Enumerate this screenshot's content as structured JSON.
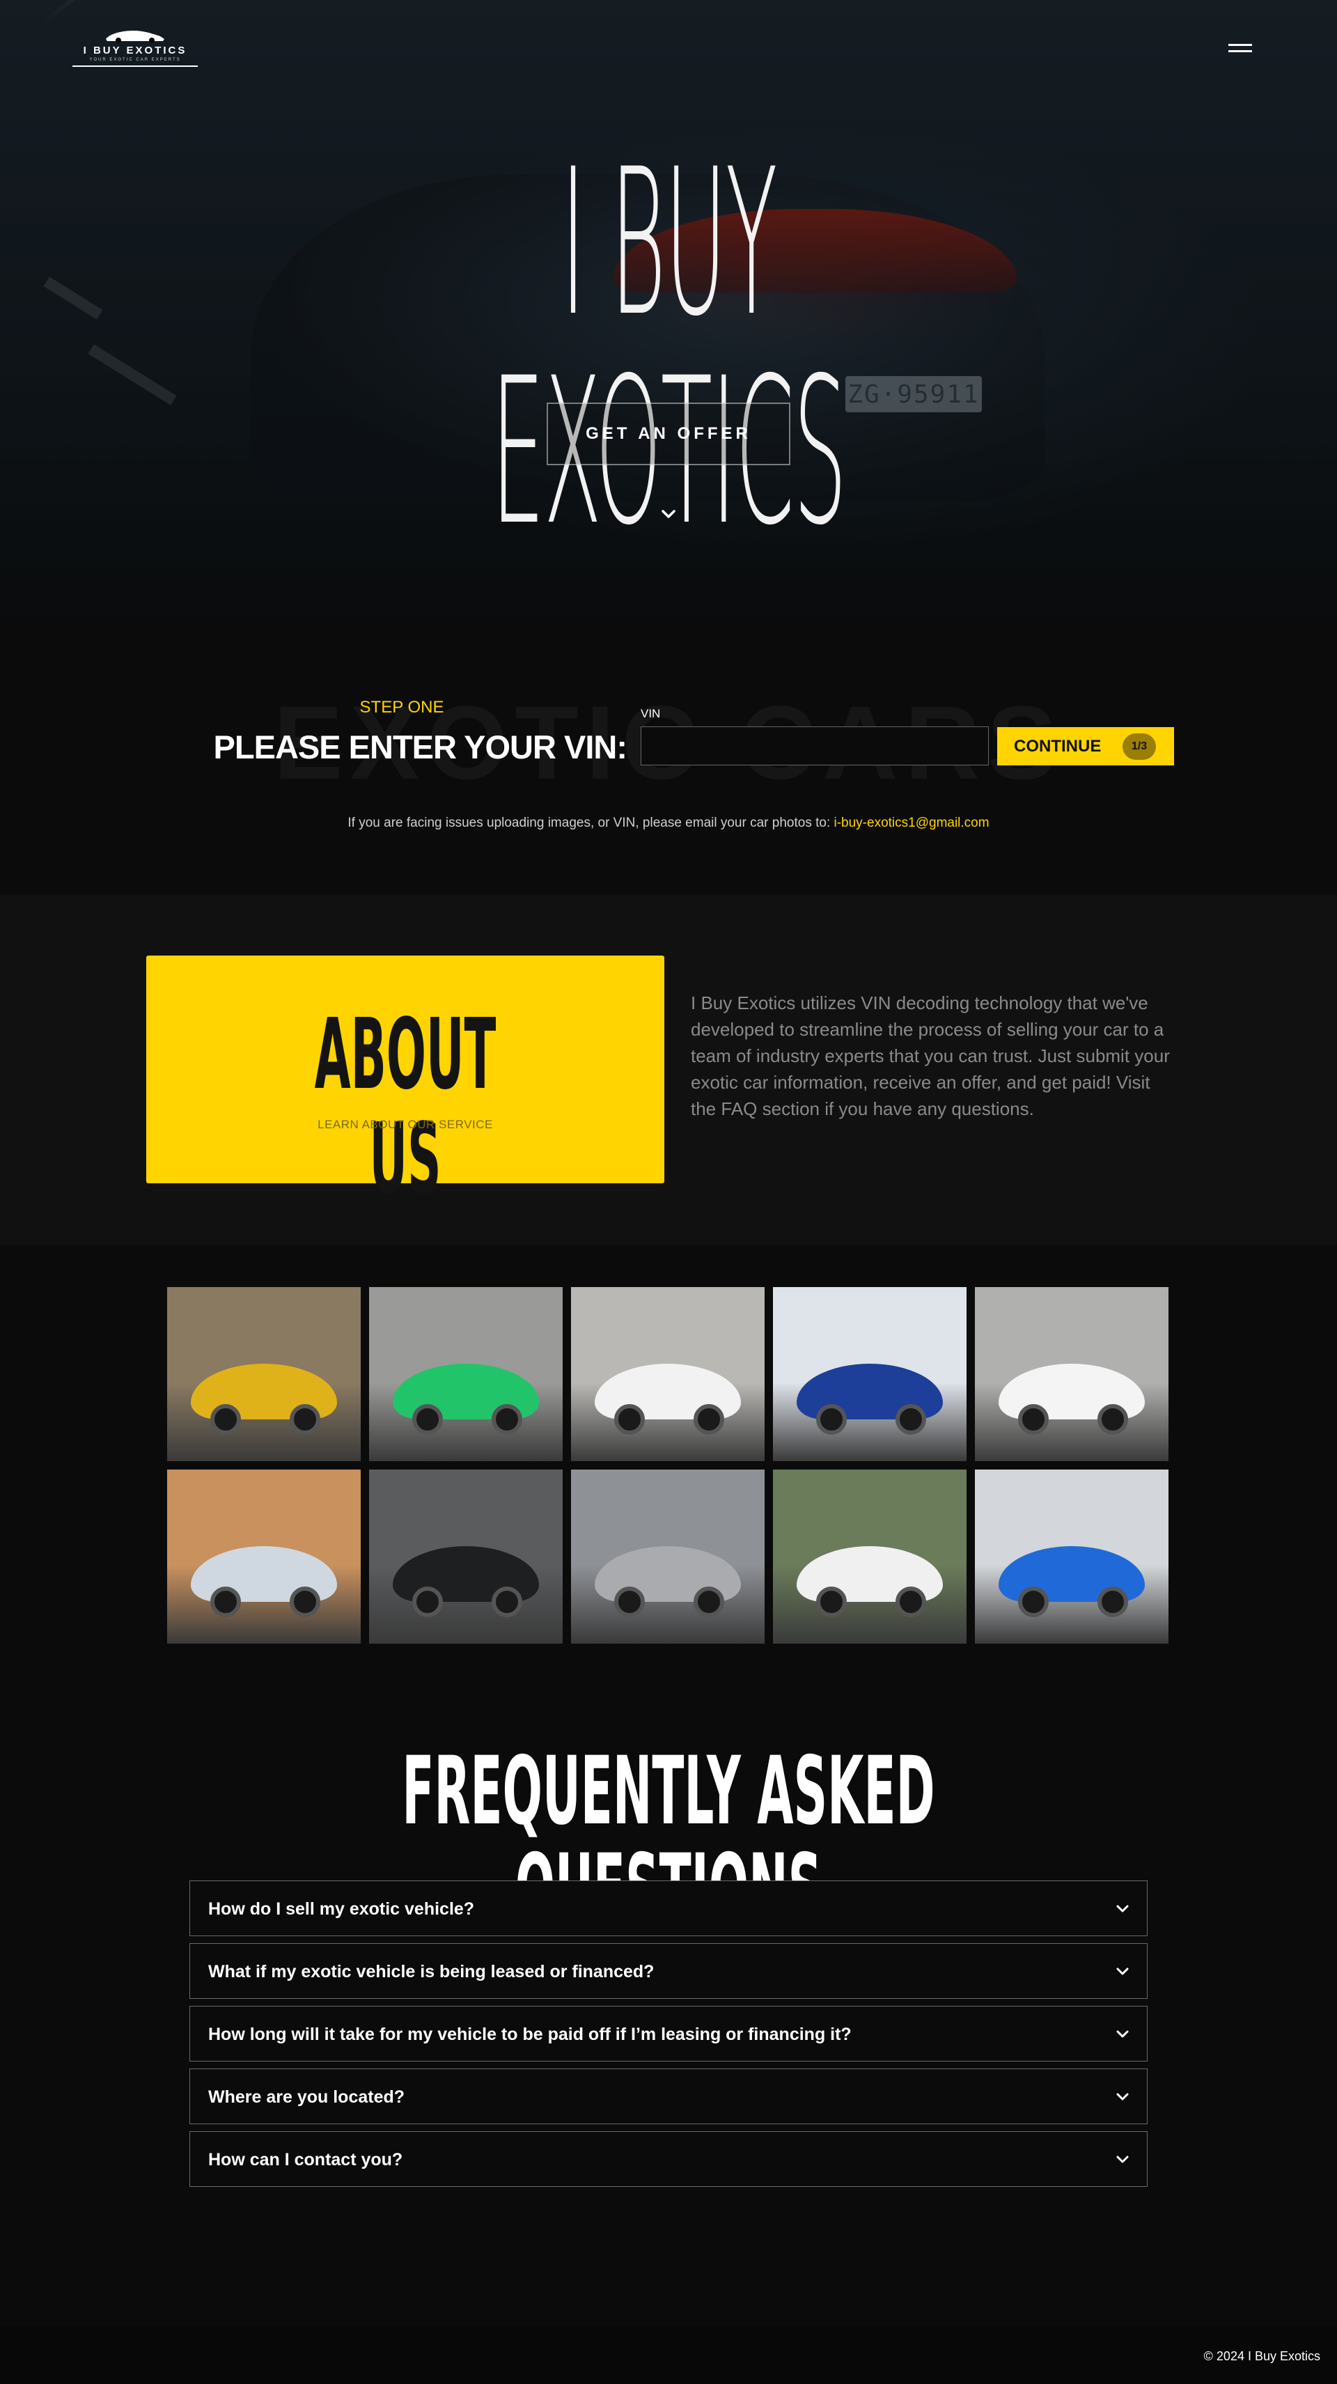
{
  "brand": {
    "logo_text": "I BUY EXOTICS",
    "logo_tagline": "YOUR EXOTIC CAR EXPERTS"
  },
  "hero": {
    "title": "I BUY EXOTICS",
    "cta_label": "GET AN OFFER",
    "plate_text": "ZG·95911"
  },
  "vin_form": {
    "watermark": "EXOTIC CARS",
    "step_label": "STEP ONE",
    "heading": "PLEASE ENTER YOUR VIN:",
    "field_label": "VIN",
    "input_value": "",
    "continue_label": "CONTINUE",
    "step_badge": "1/3",
    "note_text": "If you are facing issues uploading images, or VIN, please email your car photos to: ",
    "note_email": "i-buy-exotics1@gmail.com"
  },
  "about": {
    "title": "ABOUT US",
    "subtitle": "LEARN ABOUT OUR SERVICE",
    "body": "I Buy Exotics utilizes VIN decoding technology that we've developed to streamline the process of selling your car to a team of industry experts that you can trust. Just submit your exotic car information, receive an offer, and get paid! Visit the FAQ section if you have any questions."
  },
  "gallery": [
    {
      "name": "yellow-ferrari-photo",
      "bg": "#8a7a62",
      "car": "#e0b21a"
    },
    {
      "name": "green-porsche-photo",
      "bg": "#9a9a98",
      "car": "#22c46a"
    },
    {
      "name": "white-lamborghini-photo",
      "bg": "#b9b8b4",
      "car": "#f2f2f2"
    },
    {
      "name": "blue-nissan-gtr-photo",
      "bg": "#dfe3ea",
      "car": "#1d3f9a"
    },
    {
      "name": "white-supercar-photo",
      "bg": "#b0b0ae",
      "car": "#f4f4f4"
    },
    {
      "name": "silver-mclaren-sunset-photo",
      "bg": "#c9915e",
      "car": "#cfd8e0"
    },
    {
      "name": "black-mclaren-garage-photo",
      "bg": "#5a5c5e",
      "car": "#1e1f20"
    },
    {
      "name": "silver-porsche-gt3-photo",
      "bg": "#8e9196",
      "car": "#a9abae"
    },
    {
      "name": "white-rolls-royce-cullinan-photo",
      "bg": "#6a7c5a",
      "car": "#f0f0f0"
    },
    {
      "name": "blue-white-porsche-photo",
      "bg": "#d3d6da",
      "car": "#1f6ad8"
    }
  ],
  "faq": {
    "title": "FREQUENTLY ASKED QUESTIONS",
    "items": [
      {
        "question": "How do I sell my exotic vehicle?"
      },
      {
        "question": "What if my exotic vehicle is being leased or financed?"
      },
      {
        "question": "How long will it take for my vehicle to be paid off if I’m leasing or financing it?"
      },
      {
        "question": "Where are you located?"
      },
      {
        "question": "How can I contact you?"
      }
    ]
  },
  "footer": {
    "copyright": "© 2024 I Buy Exotics"
  },
  "colors": {
    "accent": "#ffd400",
    "background": "#0b0b0b",
    "section_alt": "#111111"
  }
}
